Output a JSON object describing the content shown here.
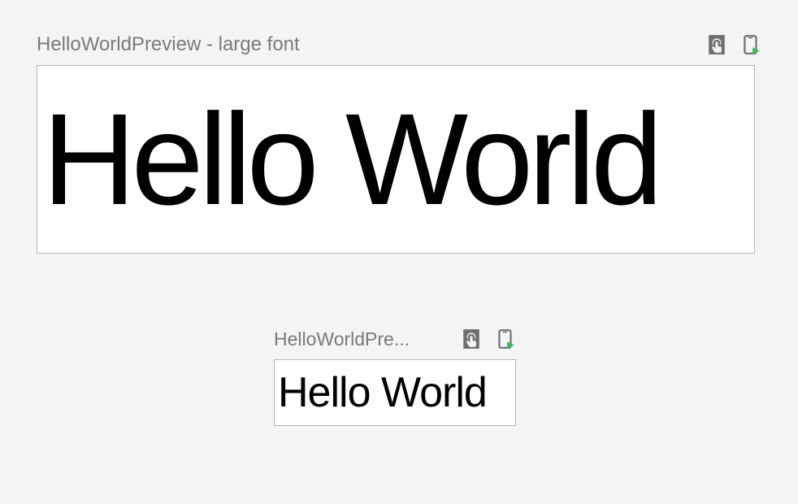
{
  "previews": [
    {
      "title": "HelloWorldPreview - large font",
      "content": "Hello World"
    },
    {
      "title": "HelloWorldPre...",
      "content": "Hello World"
    }
  ],
  "icons": {
    "interactive": "interactive-mode-icon",
    "deploy": "deploy-to-device-icon"
  }
}
